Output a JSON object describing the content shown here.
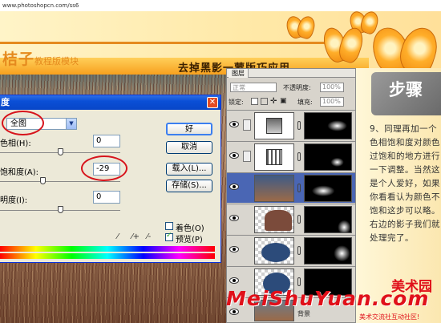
{
  "url": "www.photoshopcn.com/ss6",
  "header": {
    "site_title": "桔子",
    "site_subtitle": "教程版模块",
    "banner_title": "去掉黑影一蒙版巧应用"
  },
  "dialog": {
    "title": "度",
    "close_glyph": "✕",
    "edit_label": "全图",
    "hue_label": "色相(H):",
    "hue_value": "0",
    "hue_level": 0.5,
    "saturation_label": "饱和度(A):",
    "saturation_value": "-29",
    "saturation_level": 0.355,
    "lightness_label": "明度(I):",
    "lightness_value": "0",
    "lightness_level": 0.5,
    "buttons": {
      "ok": "好",
      "cancel": "取消",
      "load": "载入(L)...",
      "save": "存储(S)..."
    },
    "colorize_label": "着色(O)",
    "colorize_checked": false,
    "preview_label": "预览(P)",
    "preview_checked": true
  },
  "layers_panel": {
    "tab_label": "图层",
    "blend_mode": "正常",
    "opacity_label": "不透明度:",
    "opacity_value": "100%",
    "lock_label": "锁定:",
    "fill_label": "填充:",
    "fill_value": "100%",
    "bottom_label": "背景"
  },
  "sidebar": {
    "step_title": "步骤",
    "step_text": "9、同理再加一个色相饱和度对颜色过饱和的地方进行一下调整。当然这是个人爱好，如果你看看认为颜色不饱和这步可以略。右边的影子我们就处理完了。"
  },
  "watermark": {
    "logo_cn": "美术园",
    "logo_en": "MeiShuYuan.com",
    "tagline": "美术交流社互动社区!"
  },
  "colors": {
    "accent_orange": "#f7a01e",
    "xp_blue": "#0a4fd6",
    "highlight_red": "#d7141c",
    "logo_red": "#e0101a"
  }
}
